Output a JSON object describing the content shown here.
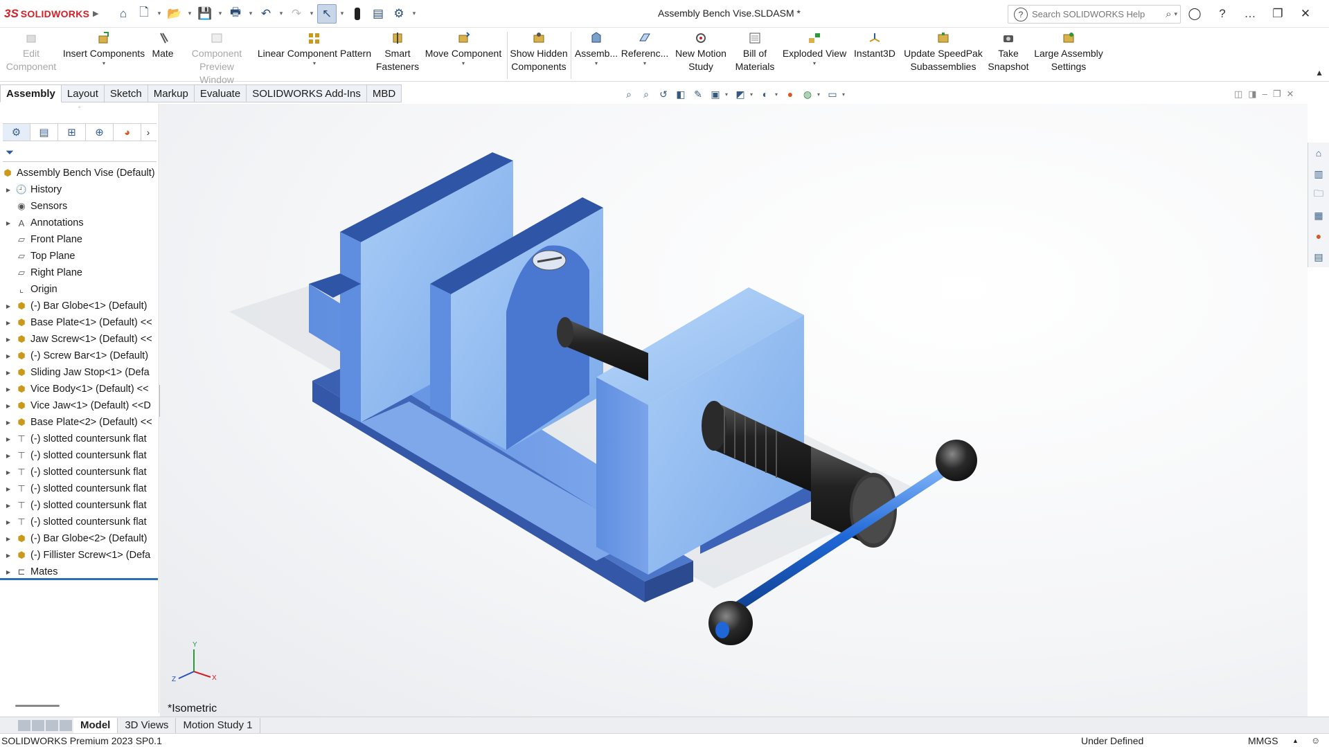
{
  "app": {
    "logo_prefix": "3S",
    "logo_text": "SOLIDWORKS",
    "document_title": "Assembly Bench Vise.SLDASM *"
  },
  "search": {
    "placeholder": "Search SOLIDWORKS Help"
  },
  "command_manager": {
    "commands": [
      {
        "label1": "Edit",
        "label2": "Component",
        "enabled": false
      },
      {
        "label1": "Insert Components",
        "label2": "",
        "enabled": true
      },
      {
        "label1": "Mate",
        "label2": "",
        "enabled": true
      },
      {
        "label1": "Component",
        "label2": "Preview Window",
        "enabled": false
      },
      {
        "label1": "Linear Component Pattern",
        "label2": "",
        "enabled": true
      },
      {
        "label1": "Smart",
        "label2": "Fasteners",
        "enabled": true
      },
      {
        "label1": "Move Component",
        "label2": "",
        "enabled": true
      },
      {
        "label1": "Show Hidden",
        "label2": "Components",
        "enabled": true
      },
      {
        "label1": "Assemb...",
        "label2": "",
        "enabled": true
      },
      {
        "label1": "Referenc...",
        "label2": "",
        "enabled": true
      },
      {
        "label1": "New Motion",
        "label2": "Study",
        "enabled": true
      },
      {
        "label1": "Bill of",
        "label2": "Materials",
        "enabled": true
      },
      {
        "label1": "Exploded View",
        "label2": "",
        "enabled": true
      },
      {
        "label1": "Instant3D",
        "label2": "",
        "enabled": true
      },
      {
        "label1": "Update SpeedPak",
        "label2": "Subassemblies",
        "enabled": true
      },
      {
        "label1": "Take",
        "label2": "Snapshot",
        "enabled": true
      },
      {
        "label1": "Large Assembly",
        "label2": "Settings",
        "enabled": true
      }
    ]
  },
  "tabs": [
    "Assembly",
    "Layout",
    "Sketch",
    "Markup",
    "Evaluate",
    "SOLIDWORKS Add-Ins",
    "MBD"
  ],
  "feature_tree": {
    "root": "Assembly Bench Vise  (Default)",
    "items": [
      {
        "label": "History",
        "expandable": true,
        "icon": "history-icon"
      },
      {
        "label": "Sensors",
        "expandable": false,
        "icon": "sensor-icon"
      },
      {
        "label": "Annotations",
        "expandable": true,
        "icon": "annotation-icon"
      },
      {
        "label": "Front Plane",
        "expandable": false,
        "icon": "plane-icon"
      },
      {
        "label": "Top Plane",
        "expandable": false,
        "icon": "plane-icon"
      },
      {
        "label": "Right Plane",
        "expandable": false,
        "icon": "plane-icon"
      },
      {
        "label": "Origin",
        "expandable": false,
        "icon": "origin-icon"
      },
      {
        "label": "(-) Bar Globe<1> (Default)",
        "expandable": true,
        "icon": "part-icon"
      },
      {
        "label": "Base Plate<1> (Default) <<",
        "expandable": true,
        "icon": "part-icon"
      },
      {
        "label": "Jaw Screw<1> (Default) <<",
        "expandable": true,
        "icon": "part-icon"
      },
      {
        "label": "(-) Screw Bar<1> (Default)",
        "expandable": true,
        "icon": "part-icon"
      },
      {
        "label": "Sliding Jaw Stop<1> (Defa",
        "expandable": true,
        "icon": "part-icon"
      },
      {
        "label": "Vice Body<1> (Default) <<",
        "expandable": true,
        "icon": "part-icon"
      },
      {
        "label": "Vice Jaw<1> (Default) <<D",
        "expandable": true,
        "icon": "part-icon"
      },
      {
        "label": "Base Plate<2> (Default) <<",
        "expandable": true,
        "icon": "part-icon"
      },
      {
        "label": "(-) slotted countersunk flat",
        "expandable": true,
        "icon": "fastener-icon"
      },
      {
        "label": "(-) slotted countersunk flat",
        "expandable": true,
        "icon": "fastener-icon"
      },
      {
        "label": "(-) slotted countersunk flat",
        "expandable": true,
        "icon": "fastener-icon"
      },
      {
        "label": "(-) slotted countersunk flat",
        "expandable": true,
        "icon": "fastener-icon"
      },
      {
        "label": "(-) slotted countersunk flat",
        "expandable": true,
        "icon": "fastener-icon"
      },
      {
        "label": "(-) slotted countersunk flat",
        "expandable": true,
        "icon": "fastener-icon"
      },
      {
        "label": "(-) Bar Globe<2> (Default)",
        "expandable": true,
        "icon": "part-icon"
      },
      {
        "label": "(-) Fillister Screw<1> (Defa",
        "expandable": true,
        "icon": "part-icon"
      },
      {
        "label": "Mates",
        "expandable": true,
        "icon": "mates-icon"
      }
    ]
  },
  "viewport": {
    "view_name": "*Isometric",
    "axis_x": "X",
    "axis_y": "Y",
    "axis_z": "Z"
  },
  "bottom_tabs": [
    "Model",
    "3D Views",
    "Motion Study 1"
  ],
  "status_bar": {
    "product": "SOLIDWORKS Premium 2023 SP0.1",
    "definition": "Under Defined",
    "units": "MMGS"
  },
  "colors": {
    "model_blue": "#6f9ae6",
    "model_light": "#a9cdf5",
    "accent": "#2f6fb6"
  }
}
